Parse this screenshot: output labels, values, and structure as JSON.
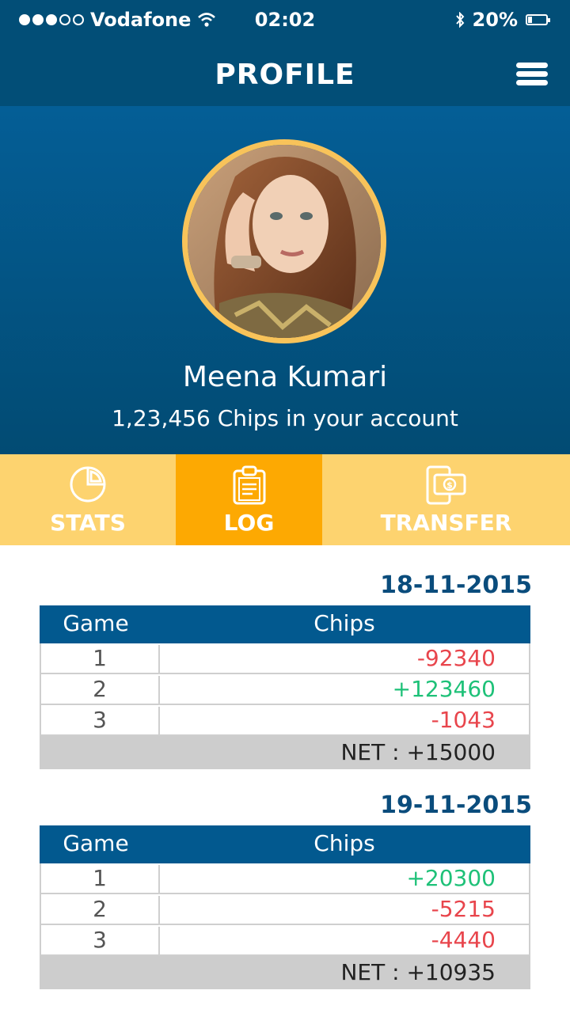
{
  "status": {
    "carrier": "Vodafone",
    "time": "02:02",
    "battery": "20%"
  },
  "header": {
    "title": "PROFILE",
    "menu_icon": "hamburger-menu-icon"
  },
  "profile": {
    "name": "Meena Kumari",
    "chips": "1,23,456 Chips in your account"
  },
  "tabs": [
    {
      "label": "STATS",
      "icon": "pie-chart-icon",
      "active": false
    },
    {
      "label": "LOG",
      "icon": "clipboard-icon",
      "active": true
    },
    {
      "label": "TRANSFER",
      "icon": "phone-money-icon",
      "active": false
    }
  ],
  "colors": {
    "header": "#024e77",
    "tab_bar": "#fdd36f",
    "tab_active": "#fda902",
    "negative": "#e8454c",
    "positive": "#1ec178"
  },
  "log": [
    {
      "date": "18-11-2015",
      "col_game": "Game",
      "col_chips": "Chips",
      "rows": [
        {
          "game": "1",
          "chips": "-92340"
        },
        {
          "game": "2",
          "chips": "+123460"
        },
        {
          "game": "3",
          "chips": "-1043"
        }
      ],
      "net": "NET :  +15000"
    },
    {
      "date": "19-11-2015",
      "col_game": "Game",
      "col_chips": "Chips",
      "rows": [
        {
          "game": "1",
          "chips": "+20300"
        },
        {
          "game": "2",
          "chips": "-5215"
        },
        {
          "game": "3",
          "chips": "-4440"
        }
      ],
      "net": "NET :  +10935"
    }
  ]
}
